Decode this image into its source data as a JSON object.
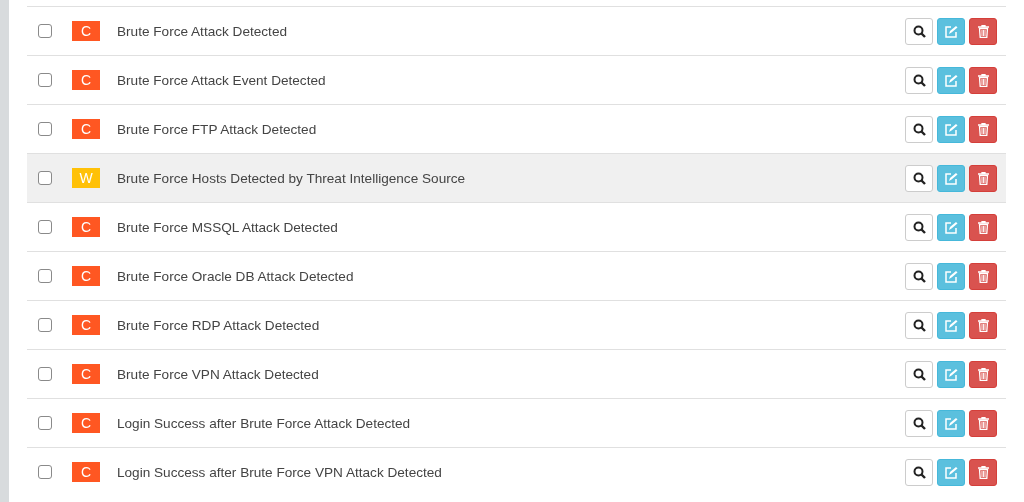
{
  "rules": [
    {
      "severity": "C",
      "color": "#ff5722",
      "name": "Brute Force Attack Detected",
      "checked": false,
      "highlighted": false
    },
    {
      "severity": "C",
      "color": "#ff5722",
      "name": "Brute Force Attack Event Detected",
      "checked": false,
      "highlighted": false
    },
    {
      "severity": "C",
      "color": "#ff5722",
      "name": "Brute Force FTP Attack Detected",
      "checked": false,
      "highlighted": false
    },
    {
      "severity": "W",
      "color": "#ffc107",
      "name": "Brute Force Hosts Detected by Threat Intelligence Source",
      "checked": false,
      "highlighted": true
    },
    {
      "severity": "C",
      "color": "#ff5722",
      "name": "Brute Force MSSQL Attack Detected",
      "checked": false,
      "highlighted": false
    },
    {
      "severity": "C",
      "color": "#ff5722",
      "name": "Brute Force Oracle DB Attack Detected",
      "checked": false,
      "highlighted": false
    },
    {
      "severity": "C",
      "color": "#ff5722",
      "name": "Brute Force RDP Attack Detected",
      "checked": false,
      "highlighted": false
    },
    {
      "severity": "C",
      "color": "#ff5722",
      "name": "Brute Force VPN Attack Detected",
      "checked": false,
      "highlighted": false
    },
    {
      "severity": "C",
      "color": "#ff5722",
      "name": "Login Success after Brute Force Attack Detected",
      "checked": false,
      "highlighted": false
    },
    {
      "severity": "C",
      "color": "#ff5722",
      "name": "Login Success after Brute Force VPN Attack Detected",
      "checked": false,
      "highlighted": false
    }
  ]
}
